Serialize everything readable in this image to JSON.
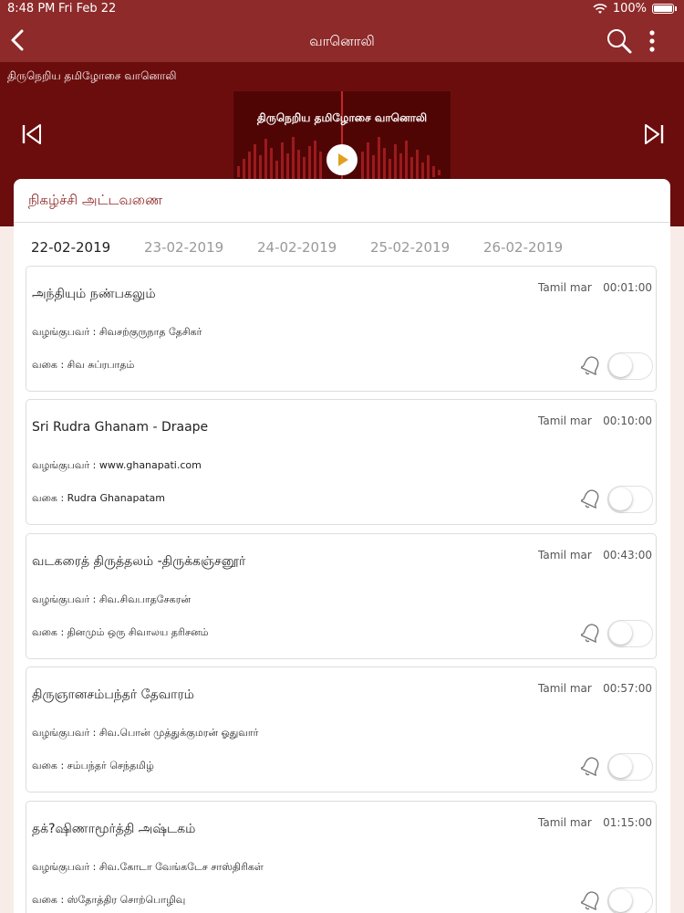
{
  "status_bar": {
    "time": "8:48 PM",
    "date": "Fri Feb 22",
    "battery": "100%"
  },
  "nav": {
    "title": "வானொலி"
  },
  "hero": {
    "caption": "திருநெறிய தமிழோசை வானொலி",
    "art_title": "திருநெறிய தமிழோசை வானொலி"
  },
  "schedule": {
    "title": "நிகழ்ச்சி அட்டவணை",
    "dates": [
      "22-02-2019",
      "23-02-2019",
      "24-02-2019",
      "25-02-2019",
      "26-02-2019"
    ],
    "active_date_index": 0
  },
  "programs": [
    {
      "title": "அந்தியும் நண்பகலும்",
      "language": "Tamil mar",
      "time": "00:01:00",
      "presenter": "வழங்குபவர் : சிவசற்குருநாத தேசிகர்",
      "category": "வகை : சிவ சுப்ரபாதம்",
      "reminder_on": false
    },
    {
      "title": "Sri Rudra Ghanam - Draape",
      "language": "Tamil mar",
      "time": "00:10:00",
      "presenter": "வழங்குபவர் : www.ghanapati.com",
      "category": "வகை : Rudra Ghanapatam",
      "reminder_on": false
    },
    {
      "title": "வடகரைத் திருத்தலம் -திருக்கஞ்சனூர்",
      "language": "Tamil mar",
      "time": "00:43:00",
      "presenter": "வழங்குபவர் : சிவ.சிவபாதசேகரன்",
      "category": "வகை : தினமும் ஒரு சிவாலய தரிசனம்",
      "reminder_on": false
    },
    {
      "title": "திருஞானசம்பந்தர் தேவாரம்",
      "language": "Tamil mar",
      "time": "00:57:00",
      "presenter": "வழங்குபவர் : சிவ.பொன் முத்துக்குமரன் ஓதுவார்",
      "category": "வகை : சம்பந்தர் செந்தமிழ்",
      "reminder_on": false
    },
    {
      "title": "தக்?ஷிணாமூர்த்தி அஷ்டகம்",
      "language": "Tamil mar",
      "time": "01:15:00",
      "presenter": "வழங்குபவர் : சிவ.கோடா வேங்கடேச சாஸ்திரிகள்",
      "category": "வகை : ஸ்தோத்திர சொற்பொழிவு",
      "reminder_on": false
    }
  ],
  "colors": {
    "header": "#8e2a2a",
    "hero_bg": "#6c0d0d",
    "accent": "#8e2a2a",
    "play_icon": "#e0a020"
  },
  "icons": {
    "back": "chevron-left-icon",
    "search": "search-icon",
    "more": "more-vertical-icon",
    "prev": "skip-previous-icon",
    "next": "skip-next-icon",
    "play": "play-icon",
    "bell": "bell-icon",
    "wifi": "wifi-icon",
    "battery": "battery-icon"
  }
}
